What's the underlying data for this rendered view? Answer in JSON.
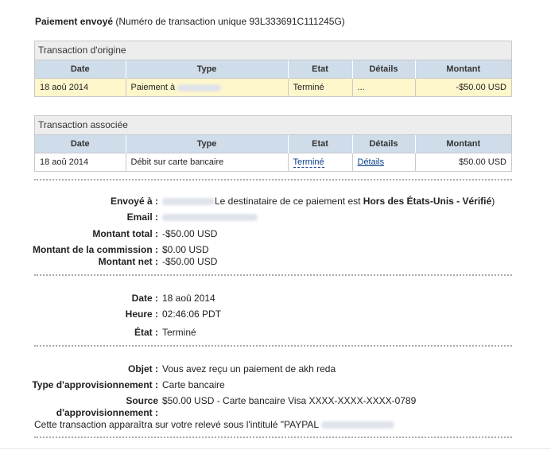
{
  "header": {
    "title_bold": "Paiement envoyé",
    "title_rest": " (Numéro de transaction unique 93L333691C111245G)"
  },
  "origin": {
    "title": "Transaction d'origine",
    "columns": [
      "Date",
      "Type",
      "Etat",
      "Détails",
      "Montant"
    ],
    "row": {
      "date": "18 aoû 2014",
      "type": "Paiement à",
      "etat": "Terminé",
      "details": "...",
      "montant": "-$50.00 USD"
    }
  },
  "associated": {
    "title": "Transaction associée",
    "columns": [
      "Date",
      "Type",
      "Etat",
      "Détails",
      "Montant"
    ],
    "row": {
      "date": "18 aoû 2014",
      "type": "Débit sur carte bancaire",
      "etat": "Terminé",
      "details": "Détails",
      "montant": "$50.00 USD"
    }
  },
  "recipient": {
    "sent_to_label": "Envoyé à :",
    "sent_to_note_pre": "Le destinataire de ce paiement est ",
    "sent_to_note_bold": "Hors des États-Unis - Vérifié",
    "sent_to_note_post": ")",
    "email_label": "Email :",
    "total_label": "Montant total :",
    "total_value": "-$50.00 USD",
    "commission_label": "Montant de la commission :",
    "commission_value": "$0.00 USD",
    "net_label": "Montant net :",
    "net_value": "-$50.00 USD"
  },
  "timing": {
    "date_label": "Date :",
    "date_value": "18 aoû 2014",
    "time_label": "Heure :",
    "time_value": "02:46:06 PDT",
    "state_label": "État :",
    "state_value": "Terminé"
  },
  "funding": {
    "subject_label": "Objet :",
    "subject_value": "Vous avez reçu un paiement de akh reda",
    "type_label": "Type d'approvisionnement :",
    "type_value": "Carte bancaire",
    "source_label_1": "Source",
    "source_label_2": "d'approvisionnement :",
    "source_value": "$50.00 USD - Carte bancaire Visa XXXX-XXXX-XXXX-0789",
    "statement_note": "Cette transaction apparaîtra sur votre relevé sous l'intitulé \"PAYPAL"
  }
}
